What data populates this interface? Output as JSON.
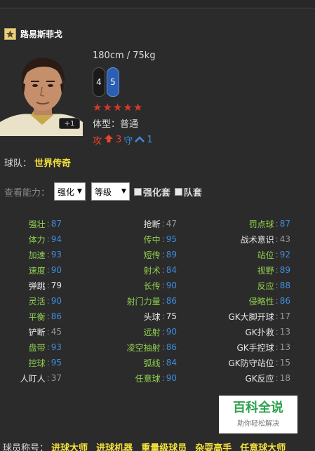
{
  "player": {
    "name": "路易斯菲戈",
    "height_weight": "180cm / 75kg",
    "left_foot": "4",
    "right_foot": "5",
    "stars": 5,
    "body_type_label": "体型：",
    "body_type": "普通",
    "plus_badge": "+1",
    "work_rate": {
      "attack_label": "攻",
      "attack_value": "3",
      "defense_label": "守",
      "defense_value": "1"
    }
  },
  "team": {
    "label": "球队：",
    "value": "世界传奇"
  },
  "controls": {
    "label": "查看能力：",
    "select1": "强化",
    "select2": "等级",
    "check1": "强化套",
    "check2": "队套"
  },
  "stats": [
    [
      {
        "name": "强壮",
        "value": "87",
        "nc": "green",
        "vc": "blue"
      },
      {
        "name": "抢断",
        "value": "47",
        "nc": "white",
        "vc": "gray"
      },
      {
        "name": "罚点球",
        "value": "87",
        "nc": "green",
        "vc": "blue"
      }
    ],
    [
      {
        "name": "体力",
        "value": "94",
        "nc": "green",
        "vc": "blue"
      },
      {
        "name": "传中",
        "value": "95",
        "nc": "green",
        "vc": "blue"
      },
      {
        "name": "战术意识",
        "value": "43",
        "nc": "white",
        "vc": "gray"
      }
    ],
    [
      {
        "name": "加速",
        "value": "93",
        "nc": "green",
        "vc": "blue"
      },
      {
        "name": "短传",
        "value": "89",
        "nc": "green",
        "vc": "blue"
      },
      {
        "name": "站位",
        "value": "92",
        "nc": "green",
        "vc": "blue"
      }
    ],
    [
      {
        "name": "速度",
        "value": "90",
        "nc": "green",
        "vc": "blue"
      },
      {
        "name": "射术",
        "value": "84",
        "nc": "green",
        "vc": "blue"
      },
      {
        "name": "视野",
        "value": "89",
        "nc": "green",
        "vc": "blue"
      }
    ],
    [
      {
        "name": "弹跳",
        "value": "79",
        "nc": "white",
        "vc": "white"
      },
      {
        "name": "长传",
        "value": "90",
        "nc": "green",
        "vc": "blue"
      },
      {
        "name": "反应",
        "value": "88",
        "nc": "green",
        "vc": "blue"
      }
    ],
    [
      {
        "name": "灵活",
        "value": "90",
        "nc": "green",
        "vc": "blue"
      },
      {
        "name": "射门力量",
        "value": "86",
        "nc": "green",
        "vc": "blue"
      },
      {
        "name": "侵略性",
        "value": "86",
        "nc": "green",
        "vc": "blue"
      }
    ],
    [
      {
        "name": "平衡",
        "value": "86",
        "nc": "green",
        "vc": "blue"
      },
      {
        "name": "头球",
        "value": "75",
        "nc": "white",
        "vc": "white"
      },
      {
        "name": "GK大脚开球",
        "value": "17",
        "nc": "white",
        "vc": "gray"
      }
    ],
    [
      {
        "name": "铲断",
        "value": "45",
        "nc": "white",
        "vc": "gray"
      },
      {
        "name": "远射",
        "value": "90",
        "nc": "green",
        "vc": "blue"
      },
      {
        "name": "GK扑救",
        "value": "13",
        "nc": "white",
        "vc": "gray"
      }
    ],
    [
      {
        "name": "盘带",
        "value": "93",
        "nc": "green",
        "vc": "blue"
      },
      {
        "name": "凌空抽射",
        "value": "86",
        "nc": "green",
        "vc": "blue"
      },
      {
        "name": "GK手控球",
        "value": "13",
        "nc": "white",
        "vc": "gray"
      }
    ],
    [
      {
        "name": "控球",
        "value": "95",
        "nc": "green",
        "vc": "blue"
      },
      {
        "name": "弧线",
        "value": "84",
        "nc": "green",
        "vc": "blue"
      },
      {
        "name": "GK防守站位",
        "value": "15",
        "nc": "white",
        "vc": "gray"
      }
    ],
    [
      {
        "name": "人盯人",
        "value": "37",
        "nc": "white",
        "vc": "gray"
      },
      {
        "name": "任意球",
        "value": "90",
        "nc": "green",
        "vc": "blue"
      },
      {
        "name": "GK反应",
        "value": "18",
        "nc": "white",
        "vc": "gray"
      }
    ]
  ],
  "watermark": {
    "title": "百科全说",
    "subtitle": "助你轻松解决"
  },
  "titles": {
    "label": "球员称号：",
    "items": [
      "进球大师",
      "进球机器",
      "重量级球员",
      "杂耍高手",
      "任意球大师"
    ]
  },
  "colors": {
    "green": "#8fd14f",
    "blue": "#3f8de0",
    "yellow": "#f5e33a",
    "red": "#d9382c"
  },
  "icons": {
    "badge": "star-badge-icon",
    "attack": "arrow-up-icon",
    "defense": "chevron-up-icon"
  }
}
